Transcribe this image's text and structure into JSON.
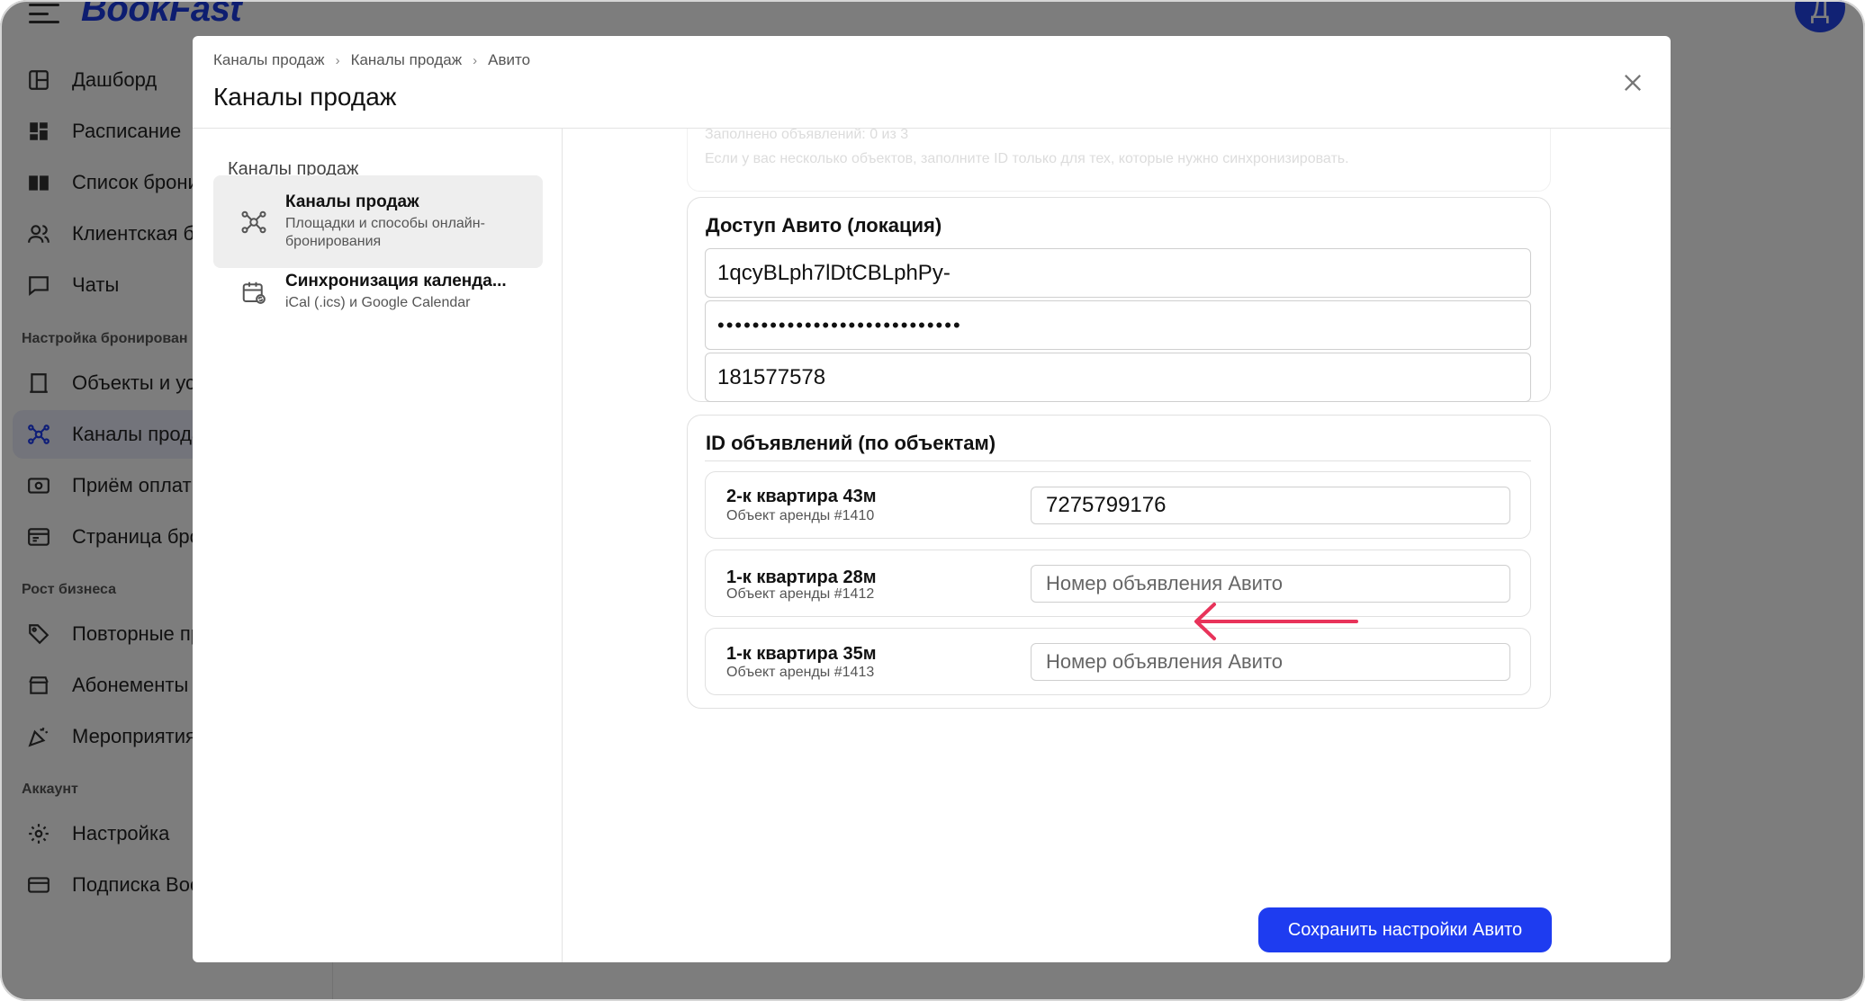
{
  "app": {
    "logo": "BookFast",
    "avatar_letter": "Д"
  },
  "sidebar": {
    "items": [
      {
        "label": "Дашборд",
        "icon": "dashboard-icon"
      },
      {
        "label": "Расписание",
        "icon": "schedule-icon"
      },
      {
        "label": "Список бронир",
        "icon": "book-icon"
      },
      {
        "label": "Клиентская ба",
        "icon": "users-icon"
      },
      {
        "label": "Чаты",
        "icon": "chat-icon"
      },
      {
        "label": "Объекты и усл",
        "icon": "door-icon"
      },
      {
        "label": "Каналы прода",
        "icon": "network-icon"
      },
      {
        "label": "Приём оплаты",
        "icon": "payment-icon"
      },
      {
        "label": "Страница брон",
        "icon": "page-icon"
      },
      {
        "label": "Повторные про",
        "icon": "tag-icon"
      },
      {
        "label": "Абонементы и",
        "icon": "store-icon"
      },
      {
        "label": "Мероприятия",
        "icon": "party-icon"
      },
      {
        "label": "Настройка",
        "icon": "gear-icon"
      },
      {
        "label": "Подписка Book",
        "icon": "card-icon"
      }
    ],
    "sections": [
      "Настройка бронирован",
      "Рост бизнеса",
      "Аккаунт"
    ]
  },
  "modal": {
    "breadcrumb": [
      "Каналы продаж",
      "Каналы продаж",
      "Авито"
    ],
    "title": "Каналы продаж",
    "side_heading": "Каналы продаж",
    "side_items": [
      {
        "title": "Каналы продаж",
        "subtitle": "Площадки и способы онлайн-бронирования"
      },
      {
        "title": "Синхронизация календа...",
        "subtitle": "iCal (.ics) и Google Calendar"
      }
    ],
    "faded_text": [
      "Заполнено объявлений: 0 из 3",
      "Если у вас несколько объектов, заполните ID только для тех, которые нужно синхронизировать."
    ],
    "access_card": {
      "title": "Доступ Авито (локация)",
      "client_id": "1qcyBLph7lDtCBLphPy-",
      "secret": "••••••••••••••••••••••••••••",
      "user_id": "181577578"
    },
    "ids_card": {
      "title": "ID объявлений (по объектам)",
      "objects": [
        {
          "name": "2-к квартира 43м",
          "sub": "Объект аренды #1410",
          "value": "7275799176",
          "placeholder": "Номер объявления Авито"
        },
        {
          "name": "1-к квартира 28м",
          "sub": "Объект аренды #1412",
          "value": "",
          "placeholder": "Номер объявления Авито"
        },
        {
          "name": "1-к квартира 35м",
          "sub": "Объект аренды #1413",
          "value": "",
          "placeholder": "Номер объявления Авито"
        }
      ]
    },
    "save_label": "Сохранить настройки Авито"
  },
  "colors": {
    "brand": "#1e3cf0",
    "annotation_arrow": "#e8335a"
  }
}
